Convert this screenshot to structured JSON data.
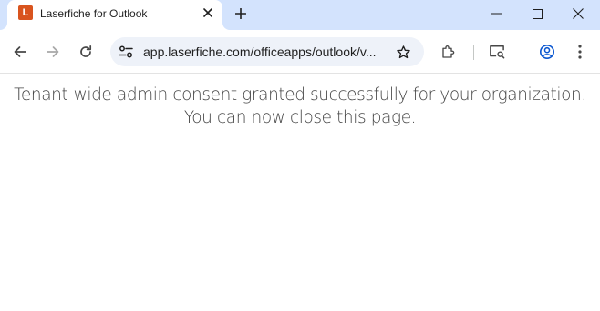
{
  "browser": {
    "tab": {
      "favicon_letter": "L",
      "favicon_color": "#d9541e",
      "title": "Laserfiche for Outlook"
    },
    "address_bar": {
      "url": "app.laserfiche.com/officeapps/outlook/v..."
    },
    "icons": {
      "tab_close": "close-icon",
      "new_tab": "plus-icon",
      "minimize": "minimize-icon",
      "maximize": "maximize-icon",
      "close": "close-icon",
      "back": "arrow-back-icon",
      "forward": "arrow-forward-icon",
      "reload": "reload-icon",
      "site_info": "tune-icon",
      "bookmark": "star-icon",
      "extensions": "puzzle-icon",
      "cast": "media-search-icon",
      "profile": "account-icon",
      "menu": "more-vert-icon"
    },
    "colors": {
      "tabstrip": "#d3e3fd",
      "omnibox": "#eef2f9"
    }
  },
  "page": {
    "message_line1": "Tenant-wide admin consent granted successfully for your organization.",
    "message_line2": "You can now close this page."
  }
}
